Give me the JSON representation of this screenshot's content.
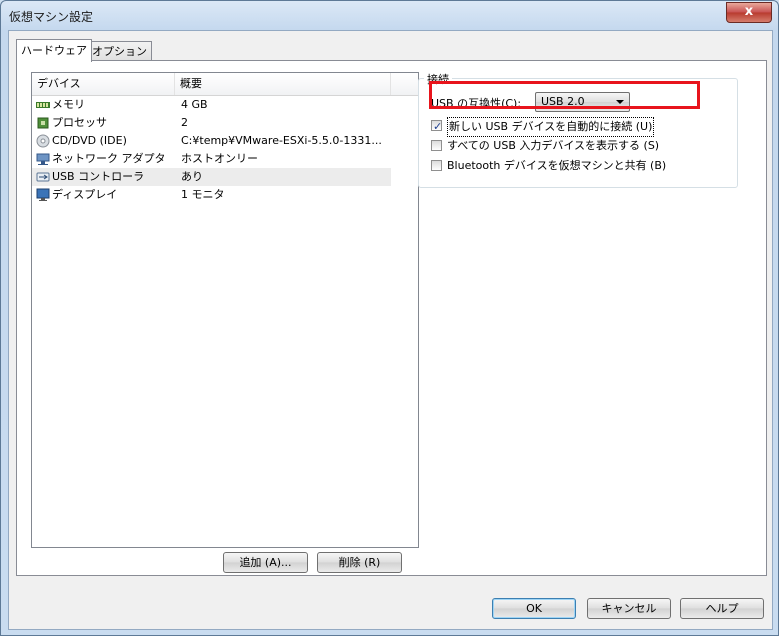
{
  "window": {
    "title": "仮想マシン設定",
    "close_label": "x"
  },
  "tabs": [
    {
      "label": "ハードウェア",
      "active": true
    },
    {
      "label": "オプション",
      "active": false
    }
  ],
  "device_list": {
    "columns": [
      "デバイス",
      "概要"
    ],
    "rows": [
      {
        "icon": "memory-icon",
        "name": "メモリ",
        "summary": "4 GB"
      },
      {
        "icon": "processor-icon",
        "name": "プロセッサ",
        "summary": "2"
      },
      {
        "icon": "cd-dvd-icon",
        "name": "CD/DVD (IDE)",
        "summary": "C:¥temp¥VMware-ESXi-5.5.0-1331..."
      },
      {
        "icon": "network-adapter-icon",
        "name": "ネットワーク アダプタ",
        "summary": "ホストオンリー"
      },
      {
        "icon": "usb-icon",
        "name": "USB コントローラ",
        "summary": "あり",
        "selected": true
      },
      {
        "icon": "display-icon",
        "name": "ディスプレイ",
        "summary": "1 モニタ"
      }
    ]
  },
  "buttons": {
    "add": "追加 (A)...",
    "remove": "削除 (R)",
    "ok": "OK",
    "cancel": "キャンセル",
    "help": "ヘルプ"
  },
  "connection": {
    "group_title": "接続",
    "usb_compat_label": "USB の互換性(C):",
    "usb_compat_value": "USB 2.0",
    "options": [
      {
        "label": "新しい USB デバイスを自動的に接続 (U)",
        "checked": true
      },
      {
        "label": "すべての USB 入力デバイスを表示する (S)",
        "checked": false
      },
      {
        "label": "Bluetooth デバイスを仮想マシンと共有 (B)",
        "checked": false
      }
    ]
  },
  "colors": {
    "highlight": "#e8141c",
    "accent": "#3c7fb1"
  }
}
